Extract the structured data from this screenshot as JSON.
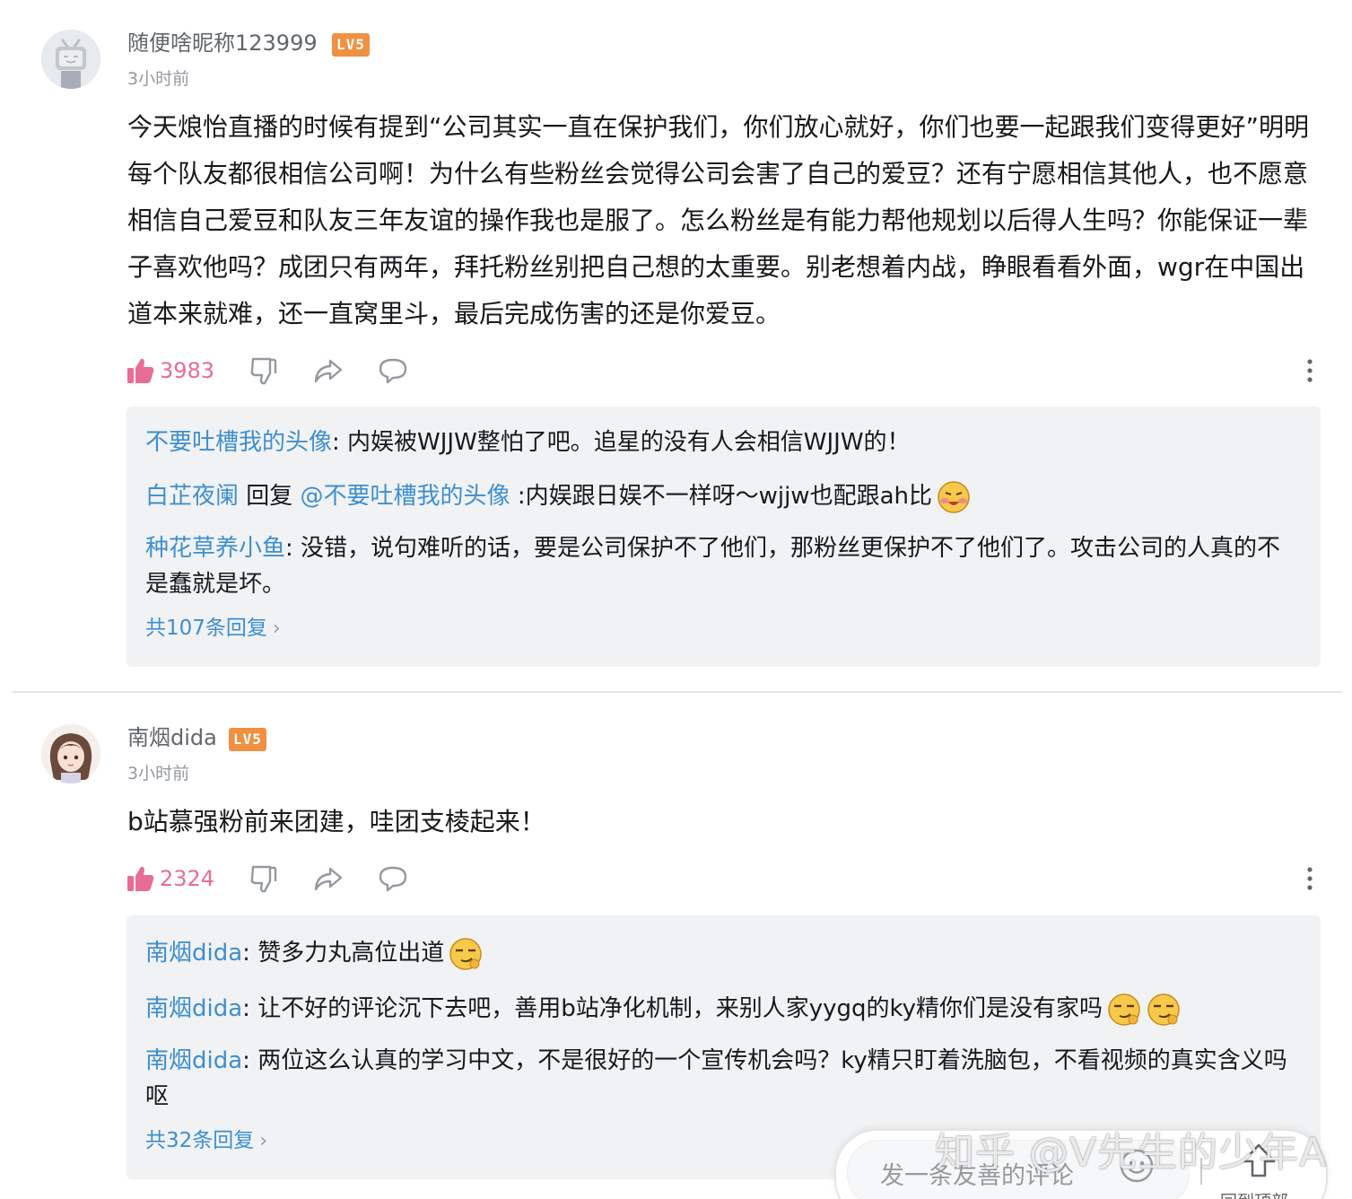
{
  "comments": [
    {
      "username": "随便啥昵称123999",
      "level": "LV5",
      "time": "3小时前",
      "avatar_icon": "tv-mascot-avatar-icon",
      "content": "今天烺怡直播的时候有提到“公司其实一直在保护我们，你们放心就好，你们也要一起跟我们变得更好”明明每个队友都很相信公司啊！为什么有些粉丝会觉得公司会害了自己的爱豆？还有宁愿相信其他人，也不愿意相信自己爱豆和队友三年友谊的操作我也是服了。怎么粉丝是有能力帮他规划以后得人生吗？你能保证一辈子喜欢他吗？成团只有两年，拜托粉丝别把自己想的太重要。别老想着内战，睁眼看看外面，wgr在中国出道本来就难，还一直窝里斗，最后完成伤害的还是你爱豆。",
      "likes": "3983",
      "replies": [
        {
          "name": "不要吐槽我的头像",
          "text": ": 内娱被WJJW整怕了吧。追星的没有人会相信WJJW的！"
        },
        {
          "name": "白芷夜阑",
          "reply_word": " 回复 ",
          "at": "@不要吐槽我的头像",
          "text": " :内娱跟日娱不一样呀～wjjw也配跟ah比",
          "emoji": "blushing-face-emoji"
        },
        {
          "name": "种花草养小鱼",
          "text": ": 没错，说句难听的话，要是公司保护不了他们，那粉丝更保护不了他们了。攻击公司的人真的不是蠢就是坏。"
        }
      ],
      "more_replies": "共107条回复"
    },
    {
      "username": "南烟dida",
      "level": "LV5",
      "time": "3小时前",
      "avatar_icon": "anime-girl-avatar-icon",
      "content": "b站慕强粉前来团建，哇团支棱起来！",
      "likes": "2324",
      "replies": [
        {
          "name": "南烟dida",
          "text": ": 赞多力丸高位出道",
          "emoji": "smirk-face-emoji"
        },
        {
          "name": "南烟dida",
          "text": ": 让不好的评论沉下去吧，善用b站净化机制，来别人家yygq的ky精你们是没有家吗",
          "emoji": "smirk-face-emoji",
          "emoji_count": 2
        },
        {
          "name": "南烟dida",
          "text": ": 两位这么认真的学习中文，不是很好的一个宣传机会吗？ky精只盯着洗脑包，不看视频的真实含义吗 呕"
        }
      ],
      "more_replies": "共32条回复"
    }
  ],
  "bottom_bar": {
    "input_placeholder": "发一条友善的评论",
    "back_to_top": "回到顶部"
  },
  "watermark": "知乎 @V先生的少年A",
  "colors": {
    "like_pink": "#e86d95",
    "link_blue": "#3d8fd1",
    "level_orange": "#f09042",
    "reply_bg": "#f1f2f3"
  }
}
